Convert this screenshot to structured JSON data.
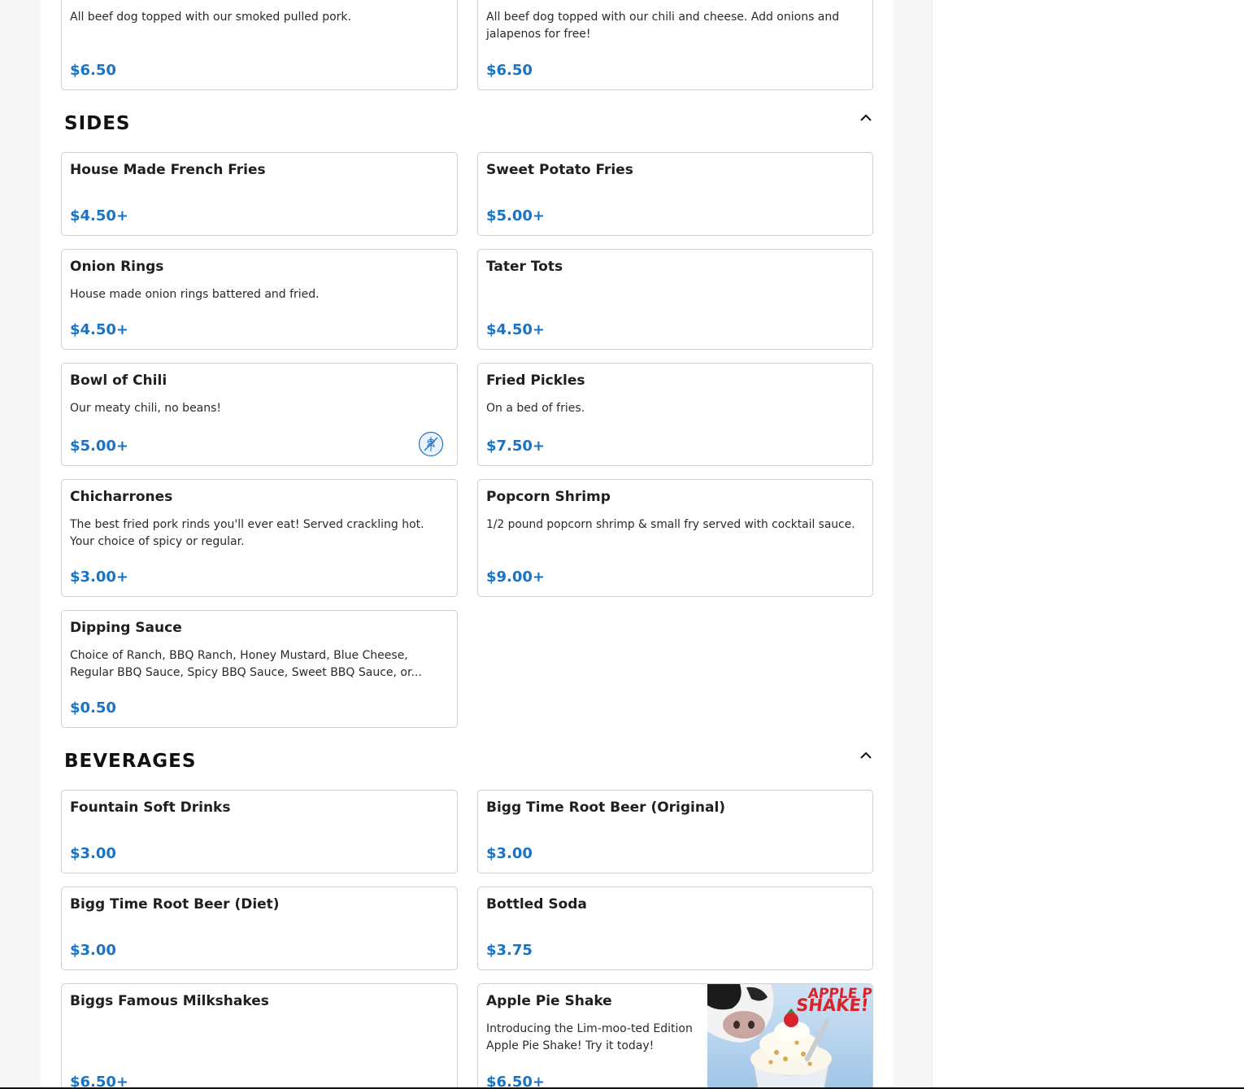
{
  "hot_dogs_tail": [
    {
      "desc": "All beef dog topped with our smoked pulled pork.",
      "price": "$6.50"
    },
    {
      "desc": "All beef dog topped with our chili and cheese. Add onions and jalapenos for free!",
      "price": "$6.50"
    }
  ],
  "sides": {
    "title": "SIDES",
    "items": [
      {
        "name": "House Made French Fries",
        "desc": "",
        "price": "$4.50+"
      },
      {
        "name": "Sweet Potato Fries",
        "desc": "",
        "price": "$5.00+"
      },
      {
        "name": "Onion Rings",
        "desc": "House made onion rings battered and fried.",
        "price": "$4.50+"
      },
      {
        "name": "Tater Tots",
        "desc": "",
        "price": "$4.50+"
      },
      {
        "name": "Bowl of Chili",
        "desc": "Our meaty chili, no beans!",
        "price": "$5.00+",
        "badge_icon": "gluten-free-icon"
      },
      {
        "name": "Fried Pickles",
        "desc": "On a bed of fries.",
        "price": "$7.50+"
      },
      {
        "name": "Chicharrones",
        "desc": "The best fried pork rinds you'll ever eat! Served crackling hot. Your choice of spicy or regular.",
        "price": "$3.00+"
      },
      {
        "name": "Popcorn Shrimp",
        "desc": "1/2 pound popcorn shrimp & small fry served with cocktail sauce.",
        "price": "$9.00+"
      },
      {
        "name": "Dipping Sauce",
        "desc": "Choice of Ranch, BBQ Ranch, Honey Mustard, Blue Cheese, Regular BBQ Sauce, Spicy BBQ Sauce, Sweet BBQ Sauce, or...",
        "price": "$0.50"
      }
    ]
  },
  "beverages": {
    "title": "BEVERAGES",
    "items": [
      {
        "name": "Fountain Soft Drinks",
        "desc": "",
        "price": "$3.00"
      },
      {
        "name": "Bigg Time Root Beer (Original)",
        "desc": "",
        "price": "$3.00"
      },
      {
        "name": "Bigg Time Root Beer (Diet)",
        "desc": "",
        "price": "$3.00"
      },
      {
        "name": "Bottled Soda",
        "desc": "",
        "price": "$3.75"
      },
      {
        "name": "Biggs Famous Milkshakes",
        "desc": "",
        "price": "$6.50+"
      },
      {
        "name": "Apple Pie Shake",
        "desc": "Introducing the Lim-moo-ted Edition Apple Pie Shake! Try it today!",
        "price": "$6.50+",
        "image_text": "APPLE PIE SHAKE!"
      }
    ]
  },
  "icons": {
    "collapse": "chevron-up-icon"
  },
  "colors": {
    "price": "#1a73c4",
    "border": "#cfcfcf",
    "background": "#f7f7f7"
  }
}
